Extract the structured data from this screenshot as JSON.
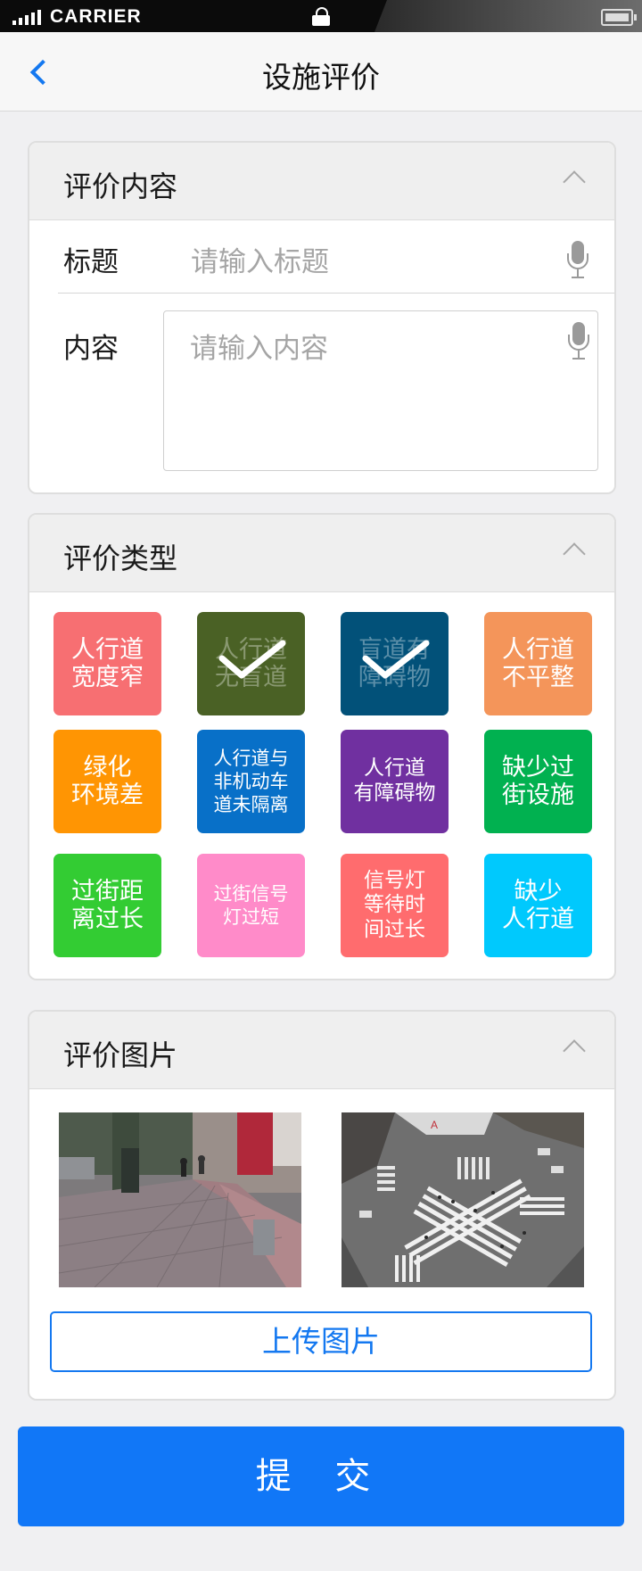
{
  "status_bar": {
    "carrier": "CARRIER"
  },
  "nav": {
    "title": "设施评价"
  },
  "section_content": {
    "header": "评价内容",
    "title_label": "标题",
    "title_placeholder": "请输入标题",
    "content_label": "内容",
    "content_placeholder": "请输入内容"
  },
  "section_type": {
    "header": "评价类型",
    "tiles": [
      {
        "label": "人行道\n宽度窄",
        "color": "#f76f72",
        "selected": false
      },
      {
        "label": "人行道\n无盲道",
        "color": "#4a6125",
        "selected": true
      },
      {
        "label": "盲道有\n障碍物",
        "color": "#025179",
        "selected": true
      },
      {
        "label": "人行道\n不平整",
        "color": "#f4955a",
        "selected": false
      },
      {
        "label": "绿化\n环境差",
        "color": "#ff9503",
        "selected": false
      },
      {
        "label": "人行道与\n非机动车\n道未隔离",
        "color": "#0870c8",
        "selected": false
      },
      {
        "label": "人行道\n有障碍物",
        "color": "#7030a0",
        "selected": false
      },
      {
        "label": "缺少过\n街设施",
        "color": "#01b150",
        "selected": false
      },
      {
        "label": "过街距\n离过长",
        "color": "#33cc33",
        "selected": false
      },
      {
        "label": "过街信号\n灯过短",
        "color": "#ff8bc9",
        "selected": false
      },
      {
        "label": "信号灯\n等待时\n间过长",
        "color": "#ff6c6e",
        "selected": false
      },
      {
        "label": "缺少\n人行道",
        "color": "#00c9fd",
        "selected": false
      }
    ]
  },
  "section_photos": {
    "header": "评价图片",
    "upload_label": "上传图片",
    "photos": [
      "sidewalk-photo",
      "crosswalk-aerial-photo"
    ]
  },
  "submit_label": "提 交"
}
